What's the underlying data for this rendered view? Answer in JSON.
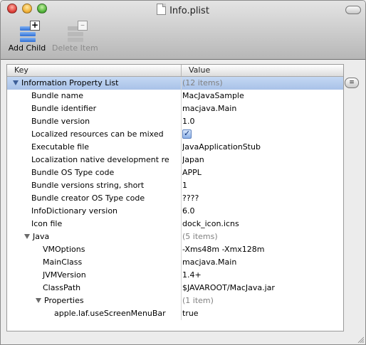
{
  "window": {
    "title": "Info.plist"
  },
  "toolbar": {
    "add_child_label": "Add Child",
    "delete_item_label": "Delete Item"
  },
  "table": {
    "columns": {
      "key": "Key",
      "value": "Value"
    },
    "rows": [
      {
        "key": "Information Property List",
        "value": "(12 items)"
      },
      {
        "key": "Bundle name",
        "value": "MacJavaSample"
      },
      {
        "key": "Bundle identifier",
        "value": "macjava.Main"
      },
      {
        "key": "Bundle version",
        "value": "1.0"
      },
      {
        "key": "Localized resources can be mixed",
        "value": "",
        "checked": true
      },
      {
        "key": "Executable file",
        "value": "JavaApplicationStub"
      },
      {
        "key": "Localization native development re",
        "value": "Japan"
      },
      {
        "key": "Bundle OS Type code",
        "value": "APPL"
      },
      {
        "key": "Bundle versions string, short",
        "value": "1"
      },
      {
        "key": "Bundle creator OS Type code",
        "value": "????"
      },
      {
        "key": "InfoDictionary version",
        "value": "6.0"
      },
      {
        "key": "Icon file",
        "value": "dock_icon.icns"
      },
      {
        "key": "Java",
        "value": "(5 items)"
      },
      {
        "key": "VMOptions",
        "value": "-Xms48m -Xmx128m"
      },
      {
        "key": "MainClass",
        "value": "macjava.Main"
      },
      {
        "key": "JVMVersion",
        "value": "1.4+"
      },
      {
        "key": "ClassPath",
        "value": "$JAVAROOT/MacJava.jar"
      },
      {
        "key": "Properties",
        "value": "(1 item)"
      },
      {
        "key": "apple.laf.useScreenMenuBar",
        "value": "true"
      }
    ]
  },
  "colors": {
    "selection": "#b6cdee",
    "muted_text": "#808080"
  }
}
